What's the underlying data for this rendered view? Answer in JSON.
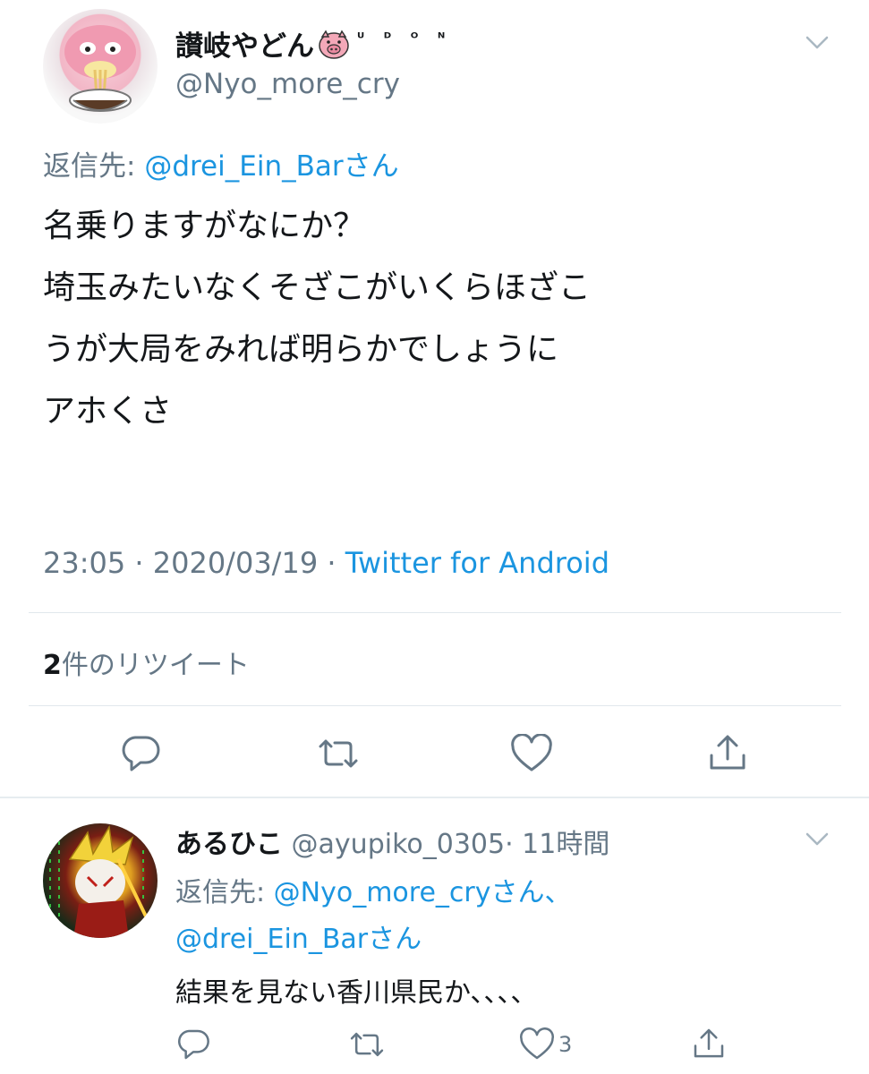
{
  "main_tweet": {
    "display_name": "讃岐やどん",
    "display_name_suffix": "ᵁ ᴰ ᴼ ᴺ",
    "handle": "@Nyo_more_cry",
    "reply_prefix": "返信先: ",
    "reply_to": "@drei_Ein_Barさん",
    "text_lines": [
      "名乗りますがなにか？",
      "埼玉みたいなくそざこがいくらほざこ",
      "うが大局をみれば明らかでしょうに",
      "アホくさ"
    ],
    "timestamp": "23:05 · 2020/03/19 · ",
    "source": "Twitter for Android",
    "retweet_count": "2",
    "retweet_label": "件のリツイート"
  },
  "reply_tweet": {
    "display_name": "あるひこ",
    "handle": "@ayupiko_0305",
    "time": "· 11時間",
    "reply_prefix": "返信先: ",
    "reply_to_1": "@Nyo_more_cryさん、",
    "reply_to_2": "@drei_Ein_Barさん",
    "text": "結果を見ない香川県民か、、、、",
    "like_count": "3"
  },
  "icons": {
    "caret": "chevron-down-icon",
    "reply": "reply-icon",
    "retweet": "retweet-icon",
    "like": "heart-icon",
    "share": "share-icon"
  },
  "colors": {
    "link": "#1b95e0",
    "secondary_text": "#657786",
    "divider": "#e1e8ed",
    "icon": "#657786"
  }
}
